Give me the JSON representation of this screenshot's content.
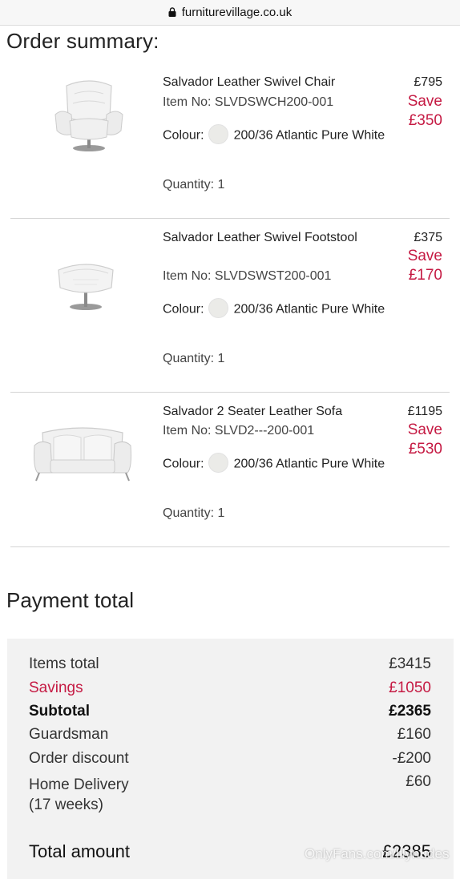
{
  "browser": {
    "url": "furniturevillage.co.uk",
    "lock_icon": "lock-icon"
  },
  "order_summary": {
    "title": "Order summary:",
    "items": [
      {
        "name": "Salvador Leather Swivel Chair",
        "sku": "Item No: SLVDSWCH200-001",
        "colour_label": "Colour:",
        "colour_value": "200/36 Atlantic Pure White",
        "quantity": "Quantity: 1",
        "price": "£795",
        "save_label": "Save",
        "save_amount": "£350",
        "image_icon": "swivel-chair-image"
      },
      {
        "name": "Salvador Leather Swivel Footstool",
        "sku": "Item No: SLVDSWST200-001",
        "colour_label": "Colour:",
        "colour_value": "200/36 Atlantic Pure White",
        "quantity": "Quantity: 1",
        "price": "£375",
        "save_label": "Save",
        "save_amount": "£170",
        "image_icon": "footstool-image"
      },
      {
        "name": "Salvador 2 Seater Leather Sofa",
        "sku": "Item No: SLVD2---200-001",
        "colour_label": "Colour:",
        "colour_value": "200/36 Atlantic Pure White",
        "quantity": "Quantity: 1",
        "price": "£1195",
        "save_label": "Save",
        "save_amount": "£530",
        "image_icon": "sofa-image"
      }
    ]
  },
  "payment": {
    "title": "Payment total",
    "rows": [
      {
        "label": "Items total",
        "value": "£3415"
      },
      {
        "label": "Savings",
        "value": "£1050"
      },
      {
        "label": "Subtotal",
        "value": "£2365"
      },
      {
        "label": "Guardsman",
        "value": "£160"
      },
      {
        "label": "Order discount",
        "value": "-£200"
      },
      {
        "label": "Home Delivery",
        "label2": "(17 weeks)",
        "value": "£60"
      }
    ],
    "total_label": "Total amount",
    "total_value": "£2385"
  },
  "watermark": "OnlyFans.com/lilynudes",
  "colors": {
    "accent": "#c51a43",
    "panel": "#f2f2f2",
    "swatch": "#ebebe8"
  }
}
